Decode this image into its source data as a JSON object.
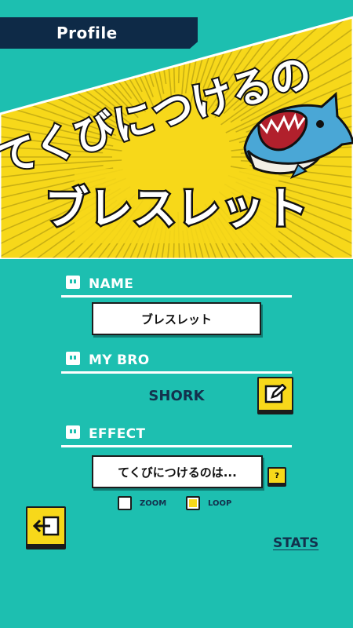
{
  "header": {
    "title": "Profile"
  },
  "banner": {
    "line1": "てくびにつけるの",
    "line2": "ブレスレット",
    "mascot_icon": "shark-icon"
  },
  "sections": {
    "name": {
      "label": "NAME",
      "value": "ブレスレット"
    },
    "my_bro": {
      "label": "MY BRO",
      "value": "SHORK",
      "edit_icon": "edit-icon"
    },
    "effect": {
      "label": "EFFECT",
      "value": "てくびにつけるのは...",
      "help_label": "?",
      "options": [
        {
          "label": "ZOOM",
          "checked": false
        },
        {
          "label": "LOOP",
          "checked": true
        }
      ]
    }
  },
  "footer": {
    "exit_icon": "exit-icon",
    "stats_label": "STATS"
  },
  "colors": {
    "background": "#1dbfb0",
    "accent": "#f7d81a",
    "navy": "#0e2a47"
  }
}
